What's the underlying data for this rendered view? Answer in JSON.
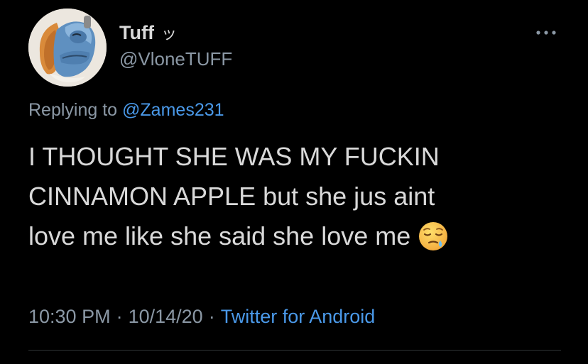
{
  "author": {
    "display_name": "Tuff",
    "name_symbol": "ッ",
    "handle": "@VloneTUFF"
  },
  "reply": {
    "prefix": "Replying to",
    "mention": "@Zames231"
  },
  "tweet": {
    "lines": [
      "I THOUGHT SHE WAS MY FUCKIN",
      "CINNAMON APPLE but she jus aint",
      "love me like she said she love me"
    ],
    "emoji": "sleepy-face-icon"
  },
  "meta": {
    "time": "10:30 PM",
    "separator": "·",
    "date": "10/14/20",
    "source": "Twitter for Android"
  },
  "icons": {
    "more": "more-horizontal-icon",
    "avatar": "avatar"
  },
  "colors": {
    "background": "#000000",
    "text": "#d9d9d9",
    "secondary": "#8b98a5",
    "link": "#4a99e9",
    "divider": "#2f3336"
  }
}
